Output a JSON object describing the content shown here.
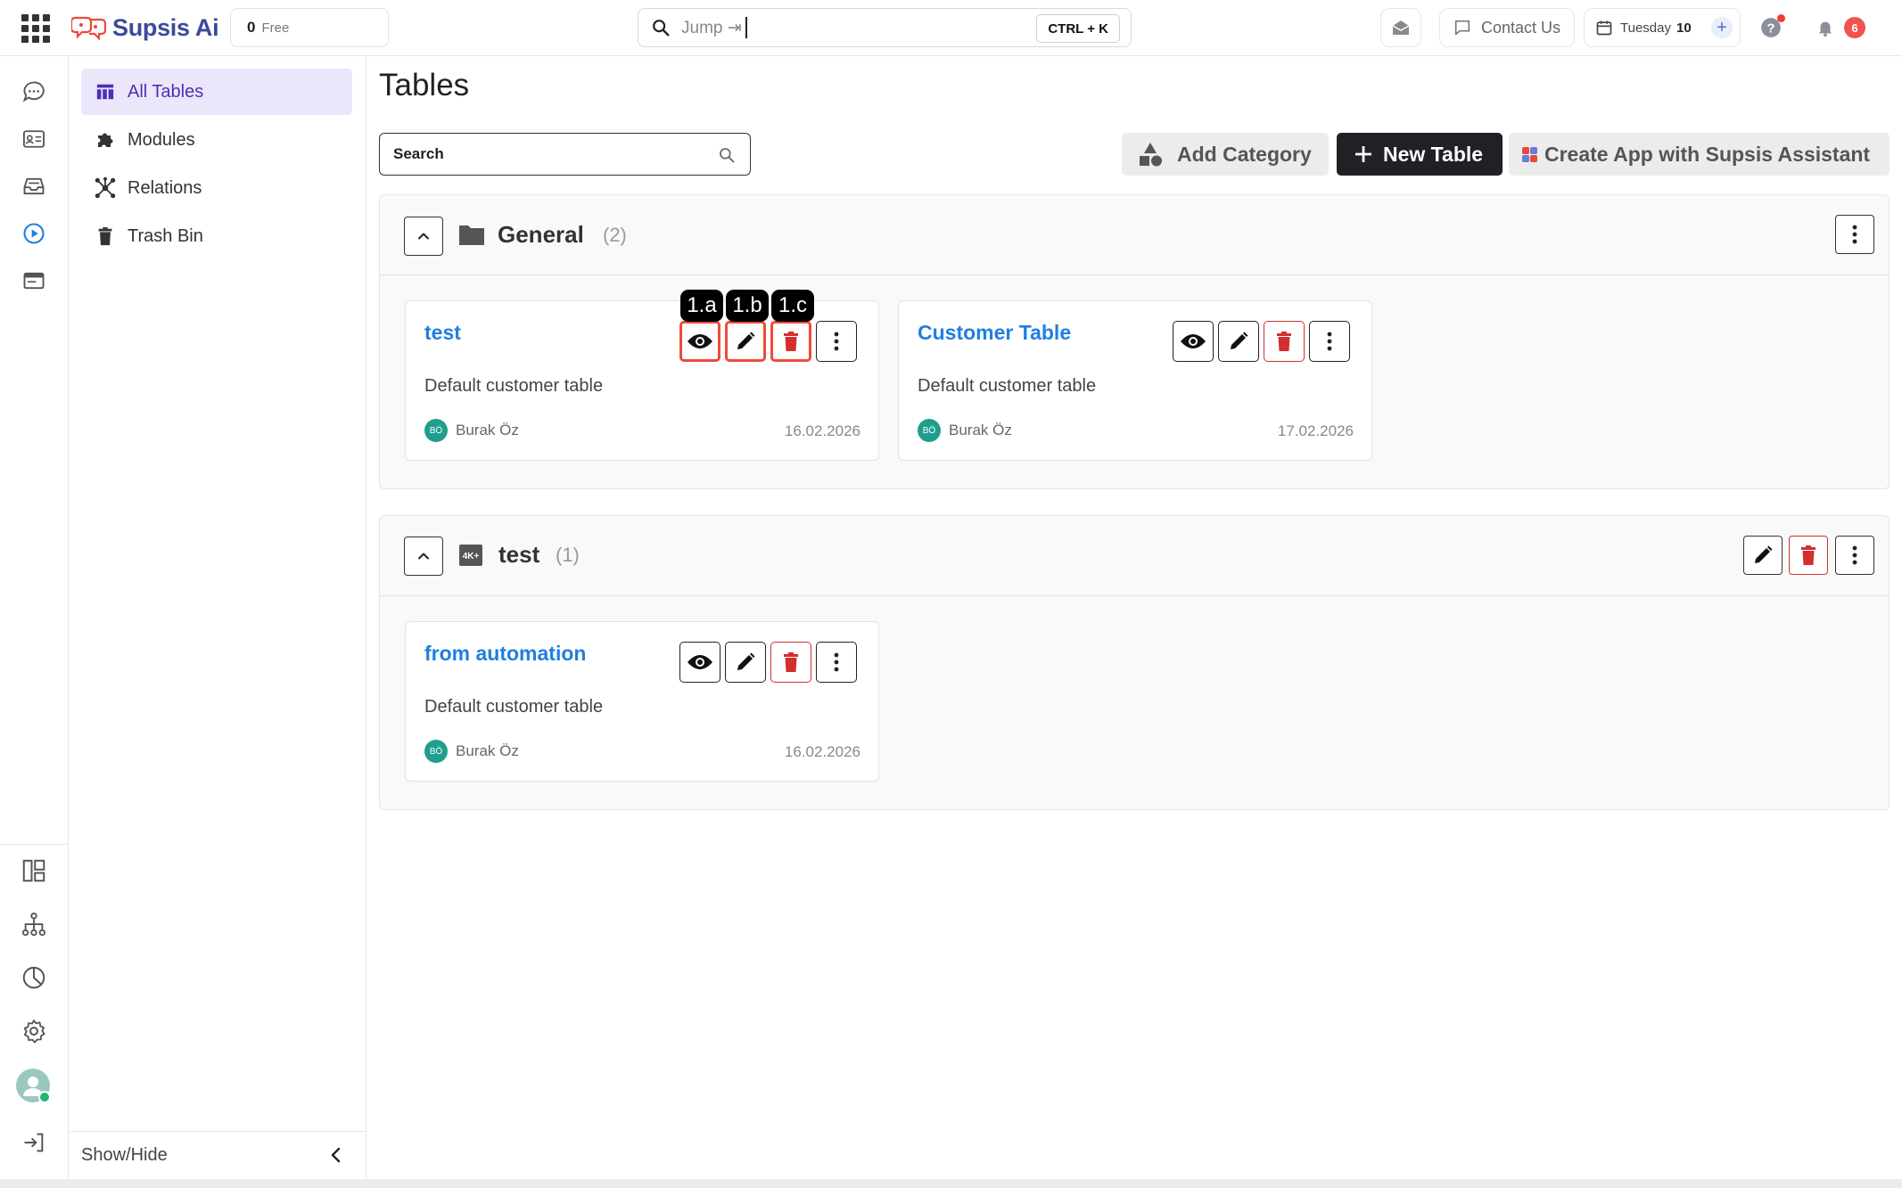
{
  "app": {
    "brand": "Supsis Ai",
    "plan_count": "0",
    "plan_label": "Free",
    "jump_placeholder": "Jump ⇥",
    "jump_shortcut": "CTRL + K",
    "contact_label": "Contact Us",
    "date_day": "Tuesday",
    "date_num": "10",
    "notif_count": "6"
  },
  "sidebar": {
    "items": [
      {
        "label": "All Tables",
        "icon": "table-icon"
      },
      {
        "label": "Modules",
        "icon": "puzzle-icon"
      },
      {
        "label": "Relations",
        "icon": "relations-icon"
      },
      {
        "label": "Trash Bin",
        "icon": "trash-icon"
      }
    ],
    "footer": "Show/Hide"
  },
  "page": {
    "title": "Tables",
    "search_label": "Search",
    "add_category": "Add Category",
    "new_table": "New Table",
    "create_app": "Create App with Supsis Assistant"
  },
  "categories": [
    {
      "name": "General",
      "count": "(2)",
      "tables": [
        {
          "title": "test",
          "description": "Default customer table",
          "owner": "Burak Öz",
          "initials": "BÖ",
          "date": "16.02.2026",
          "tags": [
            "1.a",
            "1.b",
            "1.c"
          ]
        },
        {
          "title": "Customer Table",
          "description": "Default customer table",
          "owner": "Burak Öz",
          "initials": "BÖ",
          "date": "17.02.2026"
        }
      ]
    },
    {
      "name": "test",
      "count": "(1)",
      "tables": [
        {
          "title": "from automation",
          "description": "Default customer table",
          "owner": "Burak Öz",
          "initials": "BÖ",
          "date": "16.02.2026"
        }
      ]
    }
  ],
  "colors": {
    "accent": "#4e2fb6",
    "link": "#1f7ee0",
    "danger": "#d32f2f",
    "dark_button": "#1f2125"
  }
}
